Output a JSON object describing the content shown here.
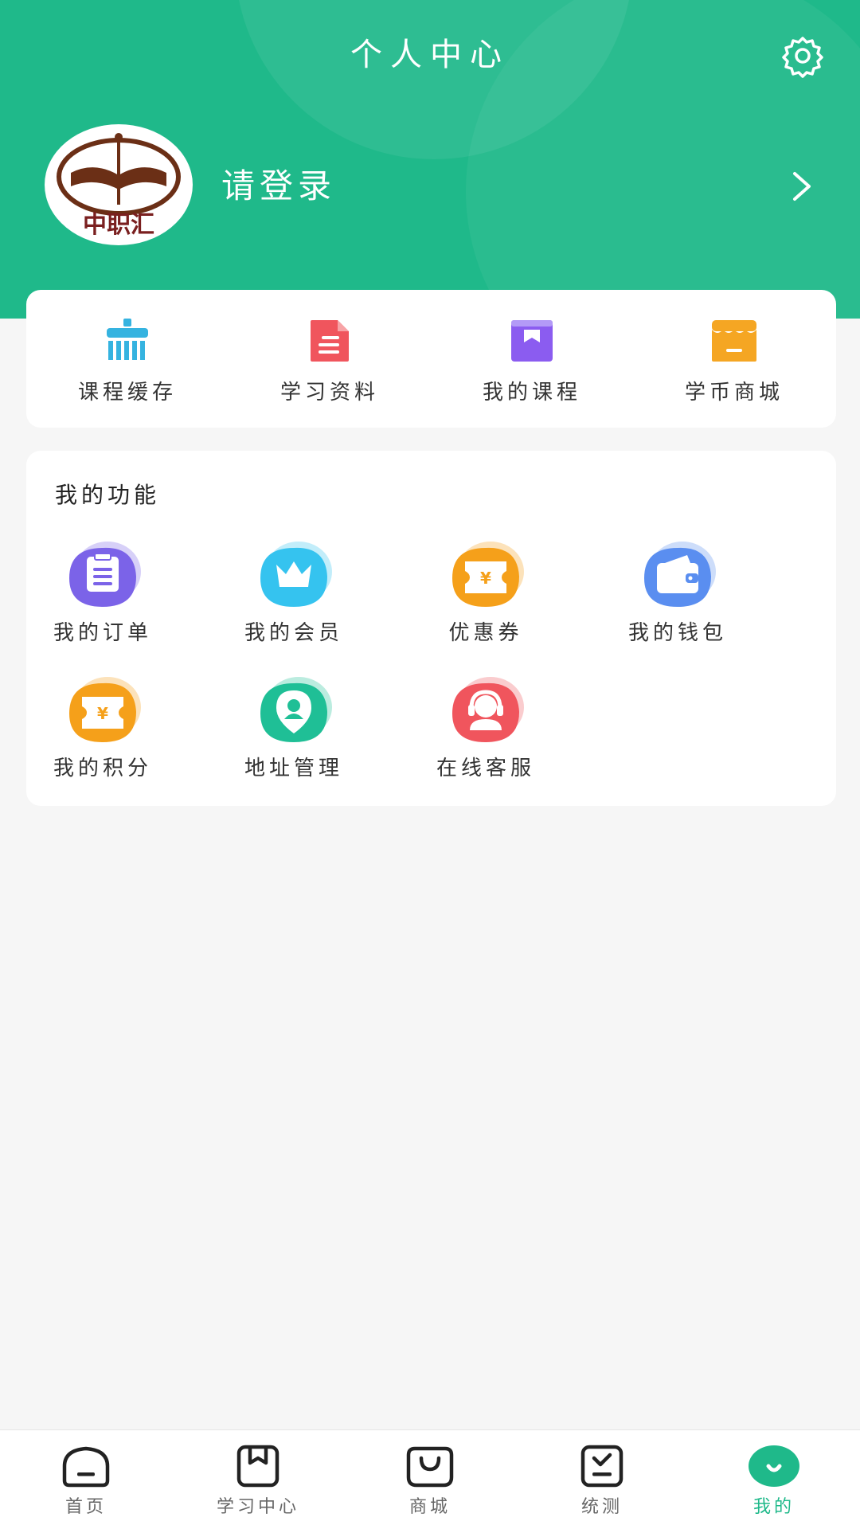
{
  "header": {
    "title": "个人中心",
    "login_text": "请登录",
    "avatar_text": "中职汇",
    "bg_color": "#1fb98a"
  },
  "quick_actions": [
    {
      "label": "课程缓存",
      "icon": "cache-icon",
      "color": "#35b3e0"
    },
    {
      "label": "学习资料",
      "icon": "document-icon",
      "color": "#f0555d"
    },
    {
      "label": "我的课程",
      "icon": "course-icon",
      "color": "#8b5cf0"
    },
    {
      "label": "学币商城",
      "icon": "store-icon",
      "color": "#f5a623"
    }
  ],
  "functions": {
    "title": "我的功能",
    "items": [
      {
        "label": "我的订单",
        "icon": "order-icon",
        "color": "#7b63e8"
      },
      {
        "label": "我的会员",
        "icon": "crown-icon",
        "color": "#35c3ef"
      },
      {
        "label": "优惠券",
        "icon": "coupon-icon",
        "color": "#f5a01a"
      },
      {
        "label": "我的钱包",
        "icon": "wallet-icon",
        "color": "#5a8ef0"
      },
      {
        "label": "我的积分",
        "icon": "points-icon",
        "color": "#f5a01a"
      },
      {
        "label": "地址管理",
        "icon": "location-icon",
        "color": "#1fbf96"
      },
      {
        "label": "在线客服",
        "icon": "customer-service-icon",
        "color": "#f0555d"
      }
    ]
  },
  "tabbar": {
    "items": [
      {
        "label": "首页",
        "icon": "home-icon"
      },
      {
        "label": "学习中心",
        "icon": "bookmark-icon"
      },
      {
        "label": "商城",
        "icon": "bag-icon"
      },
      {
        "label": "统测",
        "icon": "test-icon"
      },
      {
        "label": "我的",
        "icon": "profile-icon",
        "active": true
      }
    ],
    "active_color": "#1fb98a"
  }
}
